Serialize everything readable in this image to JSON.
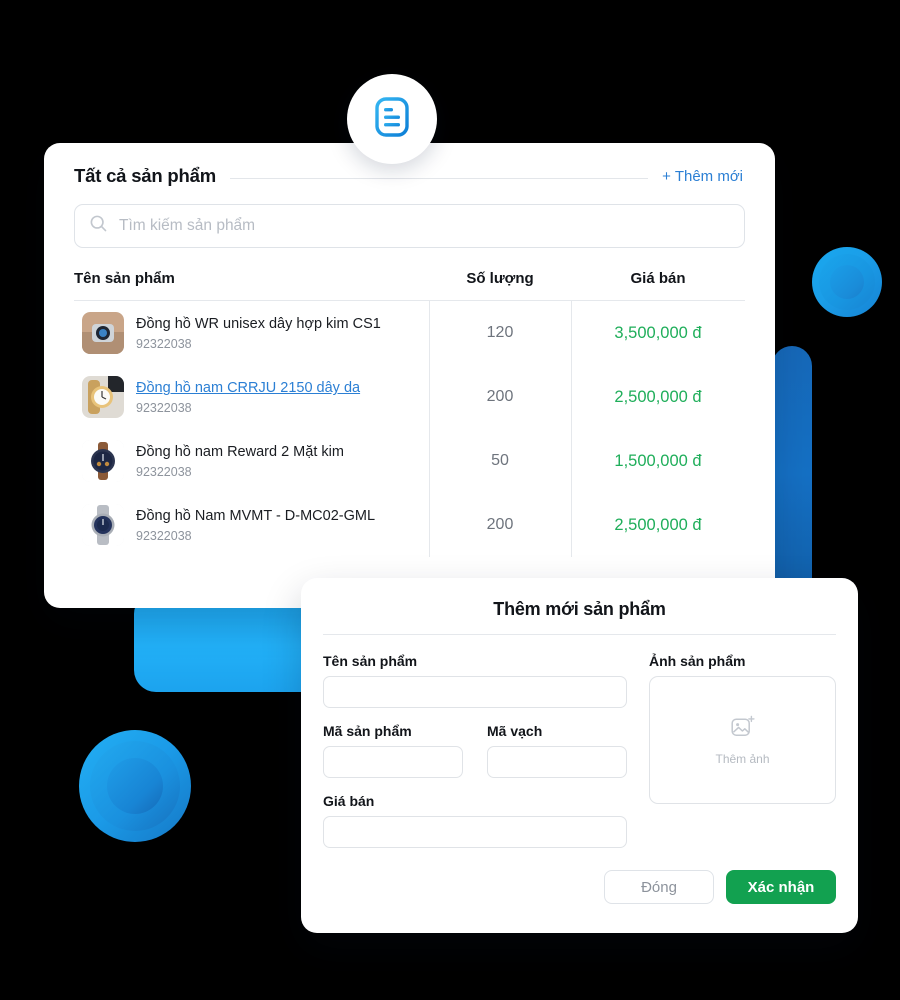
{
  "badge": {
    "icon": "document-lines-icon",
    "color": "#1a9ae6"
  },
  "card": {
    "title": "Tất cả sản phẩm",
    "add_new_label": "+ Thêm mới",
    "search": {
      "placeholder": "Tìm kiếm sản phẩm",
      "icon": "search-icon",
      "value": ""
    },
    "columns": [
      "Tên sản phẩm",
      "Số lượng",
      "Giá bán"
    ],
    "rows": [
      {
        "name": "Đồng hồ WR unisex dây hợp kim CS1",
        "code": "92322038",
        "qty": "120",
        "price": "3,500,000 đ",
        "is_link": false
      },
      {
        "name": "Đồng hồ nam CRRJU 2150 dây da",
        "code": "92322038",
        "qty": "200",
        "price": "2,500,000 đ",
        "is_link": true
      },
      {
        "name": "Đồng hồ nam Reward 2 Mặt kim",
        "code": "92322038",
        "qty": "50",
        "price": "1,500,000 đ",
        "is_link": false
      },
      {
        "name": "Đồng hồ Nam MVMT - D-MC02-GML",
        "code": "92322038",
        "qty": "200",
        "price": "2,500,000 đ",
        "is_link": false
      }
    ]
  },
  "modal": {
    "title": "Thêm mới sản phẩm",
    "fields": {
      "product_name": {
        "label": "Tên sản phẩm",
        "value": ""
      },
      "product_code": {
        "label": "Mã sản phẩm",
        "value": ""
      },
      "barcode": {
        "label": "Mã vạch",
        "value": ""
      },
      "price": {
        "label": "Giá bán",
        "value": ""
      }
    },
    "image": {
      "label": "Ảnh sản phẩm",
      "upload_label": "Thêm ảnh",
      "icon": "image-plus-icon"
    },
    "buttons": {
      "close": "Đóng",
      "confirm": "Xác nhận",
      "confirm_color": "#12a150"
    }
  },
  "colors": {
    "accent_blue": "#2b7fd4",
    "price_green": "#1fae5a",
    "deco_light_blue": "#22b0f7",
    "deco_dark_blue": "#1570c4",
    "background": "#000000"
  }
}
